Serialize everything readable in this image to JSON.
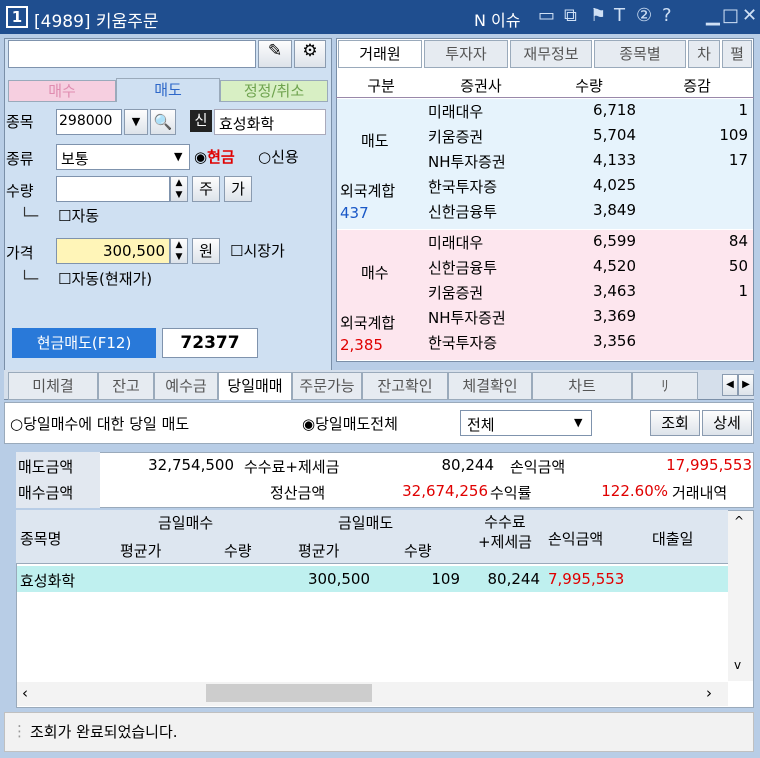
{
  "title": {
    "badge": "1",
    "text": "[4989] 키움주문",
    "news": "N 이슈"
  },
  "colors": {
    "titlebar": "#1f4e8f",
    "buy": "#fde6ee",
    "sell": "#e6f3fc",
    "selected_row": "#bff0ef"
  },
  "order": {
    "tabs": [
      "매수",
      "매도",
      "정정/취소"
    ],
    "code_label": "종목",
    "code_value": "298000",
    "badge": "신",
    "stock_name": "효성화학",
    "type_label": "종류",
    "type_value": "보통",
    "radio_cash": "현금",
    "radio_credit": "신용",
    "qty_label": "수량",
    "qty_btn1": "주",
    "qty_btn2": "가",
    "auto": "자동",
    "price_label": "가격",
    "price_value": "300,500",
    "price_unit": "원",
    "market": "시장가",
    "auto_current": "자동(현재가)",
    "submit": "현금매도(F12)",
    "acct": "72377"
  },
  "broker": {
    "tabs": [
      "거래원",
      "투자자",
      "재무정보",
      "종목별",
      "차",
      "펼"
    ],
    "headers": [
      "구분",
      "증권사",
      "수량",
      "증감"
    ],
    "sell_label": "매도",
    "sell": [
      [
        "미래대우",
        "6,718",
        "1"
      ],
      [
        "키움증권",
        "5,704",
        "109"
      ],
      [
        "NH투자증권",
        "4,133",
        "17"
      ],
      [
        "한국투자증",
        "4,025",
        ""
      ],
      [
        "신한금융투",
        "3,849",
        ""
      ]
    ],
    "foreign1_label": "외국계합",
    "foreign1_value": "437",
    "buy_label": "매수",
    "buy": [
      [
        "미래대우",
        "6,599",
        "84"
      ],
      [
        "신한금융투",
        "4,520",
        "50"
      ],
      [
        "키움증권",
        "3,463",
        "1"
      ],
      [
        "NH투자증권",
        "3,369",
        ""
      ],
      [
        "한국투자증",
        "3,356",
        ""
      ]
    ],
    "foreign2_label": "외국계합",
    "foreign2_value": "2,385"
  },
  "bottom_tabs": [
    "미체결",
    "잔고",
    "예수금",
    "당일매매",
    "주문가능",
    "잔고확인",
    "체결확인",
    "차트",
    "ﾘ"
  ],
  "filter": {
    "radio1": "당일매수에 대한 당일 매도",
    "radio2": "당일매도전체",
    "select": "전체",
    "btn_query": "조회",
    "btn_detail": "상세"
  },
  "summary": {
    "sell_amt_label": "매도금액",
    "sell_amt": "32,754,500",
    "fee_label": "수수료+제세금",
    "fee": "80,244",
    "pl_label": "손익금액",
    "pl": "17,995,553",
    "buy_amt_label": "매수금액",
    "buy_amt": "",
    "settle_label": "정산금액",
    "settle": "32,674,256",
    "rate_label": "수익률",
    "rate": "122.60%",
    "history": "거래내역"
  },
  "grid": {
    "h_name": "종목명",
    "h_buy": "금일매수",
    "h_sell": "금일매도",
    "h_fee": "수수료\n+제세금",
    "h_pl": "손익금액",
    "h_loan": "대출일",
    "sub_avg": "평균가",
    "sub_qty": "수량",
    "row": {
      "name": "효성화학",
      "buy_avg": "",
      "buy_qty": "",
      "sell_avg": "300,500",
      "sell_qty": "109",
      "fee": "80,244",
      "pl": "7,995,553",
      "loan": ""
    }
  },
  "status": "조회가 완료되었습니다."
}
